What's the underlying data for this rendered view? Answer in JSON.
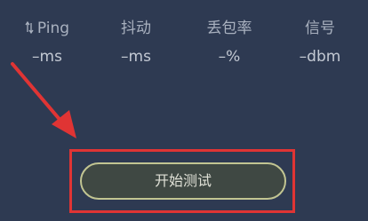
{
  "stats": {
    "ping": {
      "label": "Ping",
      "value": "–ms",
      "icon": "updown-arrows-icon"
    },
    "jitter": {
      "label": "抖动",
      "value": "–ms"
    },
    "loss": {
      "label": "丢包率",
      "value": "–%"
    },
    "signal": {
      "label": "信号",
      "value": "–dbm"
    }
  },
  "start_button": {
    "label": "开始测试"
  },
  "annotation": {
    "color": "#e03434"
  }
}
